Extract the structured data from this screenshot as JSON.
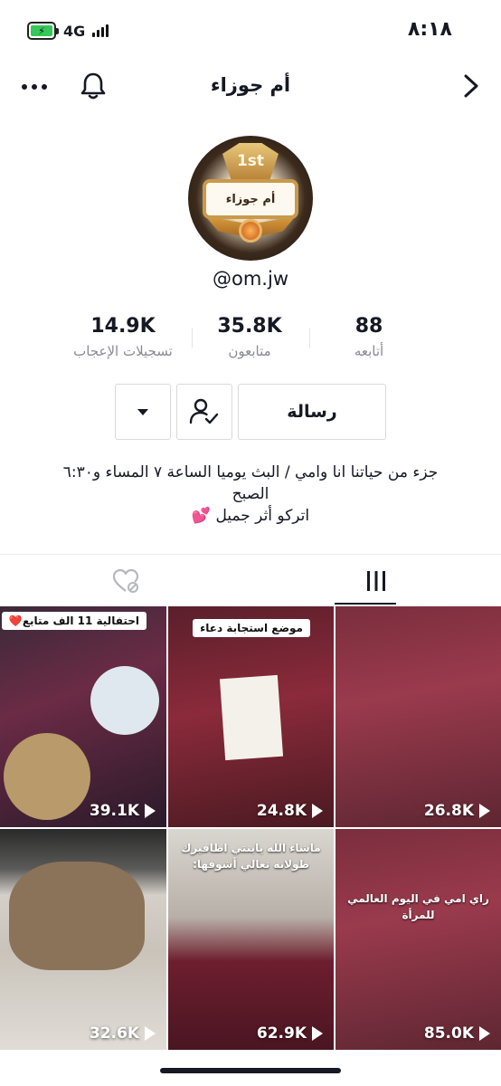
{
  "status_bar": {
    "time": "٨:١٨",
    "network": "4G"
  },
  "header": {
    "title": "أم جوزاء"
  },
  "profile": {
    "avatar_badge_rank": "1st",
    "avatar_badge_name": "أم جوزاء",
    "username": "@om.jw",
    "stats": {
      "following": {
        "value": "88",
        "label": "أتابعه"
      },
      "followers": {
        "value": "35.8K",
        "label": "متابعون"
      },
      "likes": {
        "value": "14.9K",
        "label": "تسجيلات الإعجاب"
      }
    },
    "buttons": {
      "message": "رسالة"
    },
    "bio": {
      "line1": "جزء من حياتنا انا وامي / البث يوميا الساعة ٧ المساء و٦:٣٠",
      "line2": "الصبح",
      "line3": "اتركو أثر جميل",
      "line3_emoji": "💕"
    }
  },
  "tabs": {
    "active": "videos"
  },
  "videos": [
    {
      "views": "26.8K",
      "caption": "",
      "overlay": ""
    },
    {
      "views": "24.8K",
      "caption": "موضع استجابة دعاء",
      "overlay": ""
    },
    {
      "views": "39.1K",
      "caption": "احتفالية 11 الف متابع❤️",
      "overlay": ""
    },
    {
      "views": "85.0K",
      "caption": "",
      "overlay": "راي امي في اليوم العالمي للمرأة"
    },
    {
      "views": "62.9K",
      "caption": "",
      "overlay": "ماشاء الله يابنتي اظافيرك طولانه تعالي أشوفها:"
    },
    {
      "views": "32.6K",
      "caption": "",
      "overlay": ""
    }
  ],
  "colors": {
    "text": "#161823",
    "muted": "#8a8b91",
    "border": "#dadade",
    "battery": "#34c759"
  }
}
